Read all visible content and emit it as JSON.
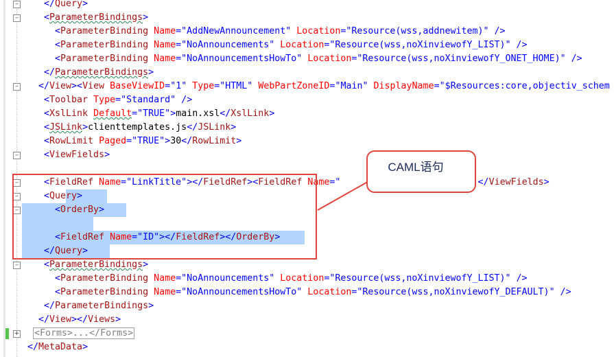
{
  "editor": {
    "lines": [
      {
        "indent": 6,
        "segments": [
          [
            "ang",
            "</"
          ],
          [
            "tag",
            "Query"
          ],
          [
            "ang",
            ">"
          ]
        ]
      },
      {
        "indent": 6,
        "segments": [
          [
            "ang",
            "<"
          ],
          [
            "tag",
            "ParameterBindings"
          ],
          [
            "ang",
            ">"
          ]
        ]
      },
      {
        "indent": 8,
        "segments": [
          [
            "ang",
            "<"
          ],
          [
            "tag",
            "ParameterBinding"
          ],
          [
            "txtc",
            " "
          ],
          [
            "attr",
            "Name"
          ],
          [
            "eq",
            "="
          ],
          [
            "val",
            "\"AddNewAnnouncement\""
          ],
          [
            "txtc",
            " "
          ],
          [
            "attr",
            "Location"
          ],
          [
            "eq",
            "="
          ],
          [
            "val",
            "\"Resource(wss,addnewitem)\""
          ],
          [
            "txtc",
            " "
          ],
          [
            "ang",
            "/>"
          ]
        ]
      },
      {
        "indent": 8,
        "segments": [
          [
            "ang",
            "<"
          ],
          [
            "tag",
            "ParameterBinding"
          ],
          [
            "txtc",
            " "
          ],
          [
            "attr",
            "Name"
          ],
          [
            "eq",
            "="
          ],
          [
            "val",
            "\"NoAnnouncements\""
          ],
          [
            "txtc",
            " "
          ],
          [
            "attr",
            "Location"
          ],
          [
            "eq",
            "="
          ],
          [
            "val",
            "\"Resource(wss,noXinviewofY_LIST)\""
          ],
          [
            "txtc",
            " "
          ],
          [
            "ang",
            "/>"
          ]
        ]
      },
      {
        "indent": 8,
        "segments": [
          [
            "ang",
            "<"
          ],
          [
            "tag",
            "ParameterBinding"
          ],
          [
            "txtc",
            " "
          ],
          [
            "attr",
            "Name"
          ],
          [
            "eq",
            "="
          ],
          [
            "val",
            "\"NoAnnouncementsHowTo\""
          ],
          [
            "txtc",
            " "
          ],
          [
            "attr",
            "Location"
          ],
          [
            "eq",
            "="
          ],
          [
            "val",
            "\"Resource(wss,noXinviewofY_ONET_HOME)\""
          ],
          [
            "txtc",
            " "
          ],
          [
            "ang",
            "/>"
          ]
        ]
      },
      {
        "indent": 6,
        "segments": [
          [
            "ang",
            "</"
          ],
          [
            "tag",
            "ParameterBindings"
          ],
          [
            "ang",
            ">"
          ]
        ]
      },
      {
        "indent": 5,
        "segments": [
          [
            "ang",
            "</"
          ],
          [
            "tag",
            "View"
          ],
          [
            "ang",
            "><"
          ],
          [
            "tag",
            "View"
          ],
          [
            "txtc",
            " "
          ],
          [
            "attr",
            "BaseViewID"
          ],
          [
            "eq",
            "="
          ],
          [
            "val",
            "\"1\""
          ],
          [
            "txtc",
            " "
          ],
          [
            "attr",
            "Type"
          ],
          [
            "eq",
            "="
          ],
          [
            "val",
            "\"HTML\""
          ],
          [
            "txtc",
            " "
          ],
          [
            "attr",
            "WebPartZoneID"
          ],
          [
            "eq",
            "="
          ],
          [
            "val",
            "\"Main\""
          ],
          [
            "txtc",
            " "
          ],
          [
            "attr",
            "DisplayName"
          ],
          [
            "eq",
            "="
          ],
          [
            "val",
            "\"$Resources:core,objectiv_schem"
          ]
        ]
      },
      {
        "indent": 6,
        "segments": [
          [
            "ang",
            "<"
          ],
          [
            "tag",
            "Toolbar"
          ],
          [
            "txtc",
            " "
          ],
          [
            "attr",
            "Type"
          ],
          [
            "eq",
            "="
          ],
          [
            "val",
            "\"Standard\""
          ],
          [
            "txtc",
            " "
          ],
          [
            "ang",
            "/>"
          ]
        ]
      },
      {
        "indent": 6,
        "segments": [
          [
            "ang",
            "<"
          ],
          [
            "tag",
            "XslLink"
          ],
          [
            "txtc",
            " "
          ],
          [
            "attr",
            "Default"
          ],
          [
            "eq",
            "="
          ],
          [
            "val",
            "\"TRUE\""
          ],
          [
            "ang",
            ">"
          ],
          [
            "txtc",
            "main.xsl"
          ],
          [
            "ang",
            "</"
          ],
          [
            "tag",
            "XslLink"
          ],
          [
            "ang",
            ">"
          ]
        ]
      },
      {
        "indent": 6,
        "segments": [
          [
            "ang",
            "<"
          ],
          [
            "tag",
            "JSLink"
          ],
          [
            "ang",
            ">"
          ],
          [
            "txtc",
            "clienttemplates.js"
          ],
          [
            "ang",
            "</"
          ],
          [
            "tag",
            "JSLink"
          ],
          [
            "ang",
            ">"
          ]
        ]
      },
      {
        "indent": 6,
        "segments": [
          [
            "ang",
            "<"
          ],
          [
            "tag",
            "RowLimit"
          ],
          [
            "txtc",
            " "
          ],
          [
            "attr",
            "Paged"
          ],
          [
            "eq",
            "="
          ],
          [
            "val",
            "\"TRUE\""
          ],
          [
            "ang",
            ">"
          ],
          [
            "txtc",
            "30"
          ],
          [
            "ang",
            "</"
          ],
          [
            "tag",
            "RowLimit"
          ],
          [
            "ang",
            ">"
          ]
        ]
      },
      {
        "indent": 6,
        "segments": [
          [
            "ang",
            "<"
          ],
          [
            "tag",
            "ViewFields"
          ],
          [
            "ang",
            ">"
          ]
        ]
      },
      {
        "indent": 0,
        "segments": []
      },
      {
        "indent": 6,
        "segments": [
          [
            "ang",
            "<"
          ],
          [
            "tag",
            "FieldRef"
          ],
          [
            "txtc",
            " "
          ],
          [
            "attr",
            "Name"
          ],
          [
            "eq",
            "="
          ],
          [
            "val",
            "\"LinkTitle\""
          ],
          [
            "ang",
            "></"
          ],
          [
            "tag",
            "FieldRef"
          ],
          [
            "ang",
            "><"
          ],
          [
            "tag",
            "FieldRef"
          ],
          [
            "txtc",
            " "
          ],
          [
            "attr",
            "Name"
          ],
          [
            "eq",
            "="
          ],
          [
            "val",
            "\""
          ],
          [
            "txtc",
            "                         "
          ],
          [
            "ang",
            "</"
          ],
          [
            "tag",
            "ViewFields"
          ],
          [
            "ang",
            ">"
          ]
        ]
      },
      {
        "indent": 6,
        "segments": [
          [
            "ang",
            "<"
          ],
          [
            "tag",
            "Query"
          ],
          [
            "ang",
            ">"
          ]
        ]
      },
      {
        "indent": 8,
        "segments": [
          [
            "ang",
            "<"
          ],
          [
            "tag",
            "OrderBy"
          ],
          [
            "ang",
            ">"
          ]
        ]
      },
      {
        "indent": 0,
        "segments": []
      },
      {
        "indent": 8,
        "segments": [
          [
            "ang",
            "<"
          ],
          [
            "tag",
            "FieldRef"
          ],
          [
            "txtc",
            " "
          ],
          [
            "attr",
            "Name"
          ],
          [
            "eq",
            "="
          ],
          [
            "val",
            "\"ID\""
          ],
          [
            "ang",
            "></"
          ],
          [
            "tag",
            "FieldRef"
          ],
          [
            "ang",
            "></"
          ],
          [
            "tag",
            "OrderBy"
          ],
          [
            "ang",
            ">"
          ]
        ]
      },
      {
        "indent": 6,
        "segments": [
          [
            "ang",
            "</"
          ],
          [
            "tag",
            "Query"
          ],
          [
            "ang",
            ">"
          ]
        ]
      },
      {
        "indent": 6,
        "segments": [
          [
            "ang",
            "<"
          ],
          [
            "tag",
            "ParameterBindings"
          ],
          [
            "ang",
            ">"
          ]
        ]
      },
      {
        "indent": 8,
        "segments": [
          [
            "ang",
            "<"
          ],
          [
            "tag",
            "ParameterBinding"
          ],
          [
            "txtc",
            " "
          ],
          [
            "attr",
            "Name"
          ],
          [
            "eq",
            "="
          ],
          [
            "val",
            "\"NoAnnouncements\""
          ],
          [
            "txtc",
            " "
          ],
          [
            "attr",
            "Location"
          ],
          [
            "eq",
            "="
          ],
          [
            "val",
            "\"Resource(wss,noXinviewofY_LIST)\""
          ],
          [
            "txtc",
            " "
          ],
          [
            "ang",
            "/>"
          ]
        ]
      },
      {
        "indent": 8,
        "segments": [
          [
            "ang",
            "<"
          ],
          [
            "tag",
            "ParameterBinding"
          ],
          [
            "txtc",
            " "
          ],
          [
            "attr",
            "Name"
          ],
          [
            "eq",
            "="
          ],
          [
            "val",
            "\"NoAnnouncementsHowTo\""
          ],
          [
            "txtc",
            " "
          ],
          [
            "attr",
            "Location"
          ],
          [
            "eq",
            "="
          ],
          [
            "val",
            "\"Resource(wss,noXinviewofY_DEFAULT)\""
          ],
          [
            "txtc",
            " "
          ],
          [
            "ang",
            "/>"
          ]
        ]
      },
      {
        "indent": 6,
        "segments": [
          [
            "ang",
            "</"
          ],
          [
            "tag",
            "ParameterBindings"
          ],
          [
            "ang",
            ">"
          ]
        ]
      },
      {
        "indent": 5,
        "segments": [
          [
            "ang",
            "</"
          ],
          [
            "tag",
            "View"
          ],
          [
            "ang",
            "></"
          ],
          [
            "tag",
            "Views"
          ],
          [
            "ang",
            ">"
          ]
        ]
      },
      {
        "indent": 4,
        "collapsed": "<Forms>...</Forms>",
        "segments": []
      },
      {
        "indent": 3,
        "segments": [
          [
            "ang",
            "</"
          ],
          [
            "tag",
            "MetaData"
          ],
          [
            "ang",
            ">"
          ]
        ]
      }
    ],
    "callout_text": "CAML语句",
    "accent": "#e0453d",
    "selection_color": "#b3d4fc"
  }
}
